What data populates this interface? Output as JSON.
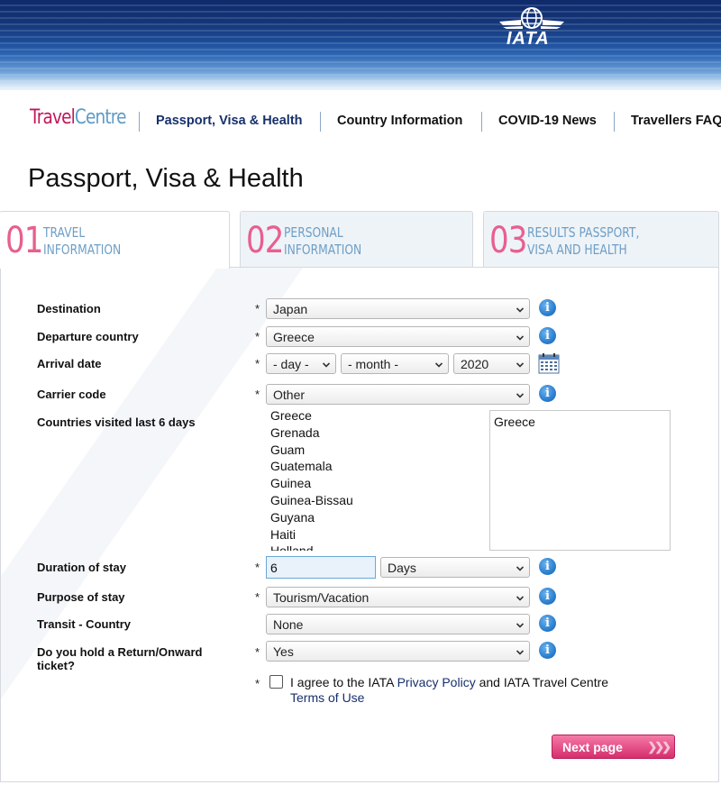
{
  "header": {
    "logo_text": "IATA"
  },
  "nav": {
    "brand_part1": "Travel",
    "brand_part2": "Centre",
    "items": [
      "Passport, Visa & Health",
      "Country Information",
      "COVID-19 News",
      "Travellers FAQ"
    ]
  },
  "page_title": "Passport, Visa & Health",
  "steps": [
    {
      "number": "01",
      "label": "Travel\nInformation",
      "active": true
    },
    {
      "number": "02",
      "label": "Personal\nInformation",
      "active": false
    },
    {
      "number": "03",
      "label": "Results Passport,\nVisa and Health",
      "active": false
    }
  ],
  "form": {
    "required_marker": "*",
    "destination": {
      "label": "Destination",
      "value": "Japan"
    },
    "departure": {
      "label": "Departure country",
      "value": "Greece"
    },
    "arrival": {
      "label": "Arrival date",
      "day": "- day -",
      "month": "- month -",
      "year": "2020"
    },
    "carrier": {
      "label": "Carrier code",
      "value": "Other"
    },
    "visited": {
      "label": "Countries visited last 6 days",
      "options": [
        "Greece",
        "Grenada",
        "Guam",
        "Guatemala",
        "Guinea",
        "Guinea-Bissau",
        "Guyana",
        "Haiti",
        "Holland"
      ],
      "selected": [
        "Greece"
      ]
    },
    "duration": {
      "label": "Duration of stay",
      "value": "6",
      "unit": "Days"
    },
    "purpose": {
      "label": "Purpose of stay",
      "value": "Tourism/Vacation"
    },
    "transit": {
      "label": "Transit - Country",
      "value": "None"
    },
    "return_ticket": {
      "label": "Do you hold a Return/Onward ticket?",
      "value": "Yes"
    },
    "agree": {
      "prefix": "I agree to the IATA ",
      "privacy_link": "Privacy Policy",
      "middle": " and IATA Travel Centre ",
      "terms_link": "Terms of Use"
    },
    "next_label": "Next page",
    "next_arrows": "❯❯❯"
  },
  "icons": {
    "info": "info-icon",
    "calendar": "calendar-icon",
    "caret": "chevron-down-icon"
  },
  "colors": {
    "brand_pink": "#c2185b",
    "brand_blue": "#5f9bc6",
    "step_number": "#e85f8f",
    "step_label": "#6d9ec6",
    "nav_active": "#17306b",
    "button": "#d52e6d"
  }
}
